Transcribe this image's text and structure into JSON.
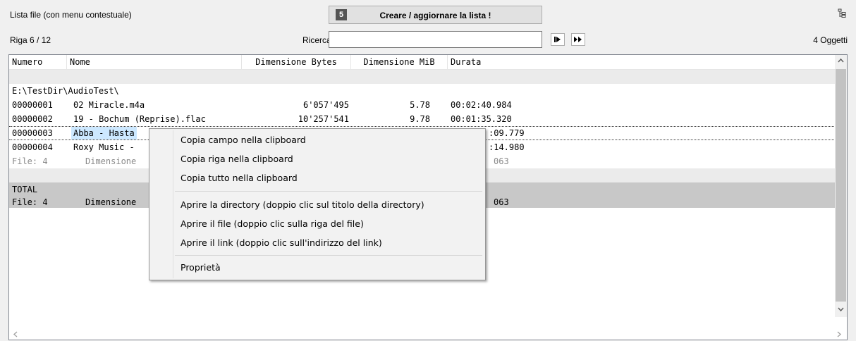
{
  "toolbar": {
    "list_title": "Lista file (con menu contestuale)",
    "create_badge": "5",
    "create_label": "Creare / aggiornare la lista !",
    "row_status": "Riga 6 / 12",
    "search_label": "Ricerca",
    "search_value": "",
    "objects_count": "4 Oggetti"
  },
  "table": {
    "columns": [
      "Numero",
      "Nome",
      "Dimensione Bytes",
      "Dimensione MiB",
      "Durata"
    ],
    "directory": "E:\\TestDir\\AudioTest\\",
    "rows": [
      {
        "num": "00000001",
        "name": "02 Miracle.m4a",
        "bytes": "6'057'495",
        "mib": "5.78",
        "dur": "00:02:40.984"
      },
      {
        "num": "00000002",
        "name": "19 - Bochum (Reprise).flac",
        "bytes": "10'257'541",
        "mib": "9.78",
        "dur": "00:01:35.320"
      },
      {
        "num": "00000003",
        "name": "Abba - Hasta",
        "dur_visible": ":09.779"
      },
      {
        "num": "00000004",
        "name": "Roxy Music -",
        "dur_visible": ":14.980"
      }
    ],
    "summary": {
      "files": "File: 4",
      "dim": "Dimensione",
      "tail": "063"
    },
    "total": {
      "label": "TOTAL",
      "files": "File: 4",
      "dim": "Dimensione",
      "tail": "063"
    }
  },
  "context_menu": {
    "items": [
      "Copia campo nella clipboard",
      "Copia riga nella clipboard",
      "Copia tutto nella clipboard",
      "Aprire la directory  (doppio clic sul titolo della directory)",
      "Aprire il file  (doppio clic sulla riga del file)",
      "Aprire il link  (doppio clic sull'indirizzo del link)",
      "Proprietà"
    ]
  },
  "colors": {
    "selection": "#cce8ff",
    "band": "#ebebeb",
    "total_band": "#c8c8c8"
  }
}
